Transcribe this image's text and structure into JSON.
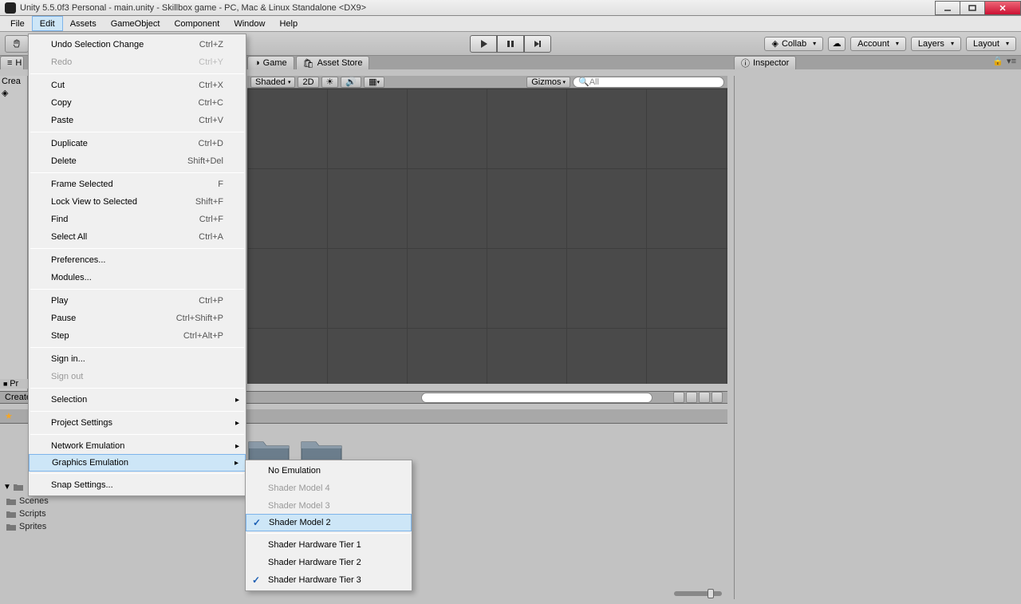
{
  "window": {
    "title": "Unity 5.5.0f3 Personal - main.unity - Skillbox game - PC, Mac & Linux Standalone <DX9>"
  },
  "menubar": {
    "file": "File",
    "edit": "Edit",
    "assets": "Assets",
    "gameobject": "GameObject",
    "component": "Component",
    "window": "Window",
    "help": "Help"
  },
  "toolbar": {
    "collab": "Collab",
    "account": "Account",
    "layers": "Layers",
    "layout": "Layout"
  },
  "tabs": {
    "hierarchy": "H",
    "game": "Game",
    "assetstore": "Asset Store",
    "inspector": "Inspector",
    "project": "P"
  },
  "scene_toolbar": {
    "shaded": "Shaded",
    "twod": "2D",
    "gizmos": "Gizmos",
    "search_placeholder": "All"
  },
  "edit_menu": {
    "undo": {
      "l": "Undo Selection Change",
      "s": "Ctrl+Z"
    },
    "redo": {
      "l": "Redo",
      "s": "Ctrl+Y"
    },
    "cut": {
      "l": "Cut",
      "s": "Ctrl+X"
    },
    "copy": {
      "l": "Copy",
      "s": "Ctrl+C"
    },
    "paste": {
      "l": "Paste",
      "s": "Ctrl+V"
    },
    "duplicate": {
      "l": "Duplicate",
      "s": "Ctrl+D"
    },
    "delete": {
      "l": "Delete",
      "s": "Shift+Del"
    },
    "frame": {
      "l": "Frame Selected",
      "s": "F"
    },
    "lockview": {
      "l": "Lock View to Selected",
      "s": "Shift+F"
    },
    "find": {
      "l": "Find",
      "s": "Ctrl+F"
    },
    "selectall": {
      "l": "Select All",
      "s": "Ctrl+A"
    },
    "prefs": {
      "l": "Preferences..."
    },
    "modules": {
      "l": "Modules..."
    },
    "play": {
      "l": "Play",
      "s": "Ctrl+P"
    },
    "pause": {
      "l": "Pause",
      "s": "Ctrl+Shift+P"
    },
    "step": {
      "l": "Step",
      "s": "Ctrl+Alt+P"
    },
    "signin": {
      "l": "Sign in..."
    },
    "signout": {
      "l": "Sign out"
    },
    "selection": {
      "l": "Selection"
    },
    "projectsettings": {
      "l": "Project Settings"
    },
    "networkemu": {
      "l": "Network Emulation"
    },
    "graphicsemu": {
      "l": "Graphics Emulation"
    },
    "snap": {
      "l": "Snap Settings..."
    }
  },
  "graphics_submenu": {
    "noemulation": "No Emulation",
    "sm4": "Shader Model 4",
    "sm3": "Shader Model 3",
    "sm2": "Shader Model 2",
    "tier1": "Shader Hardware Tier 1",
    "tier2": "Shader Hardware Tier 2",
    "tier3": "Shader Hardware Tier 3"
  },
  "project": {
    "create": "Create",
    "folders": {
      "scenes": "Scenes",
      "scripts": "Scripts",
      "sprites": "Sprites"
    }
  },
  "hierarchy": {
    "create": "Crea"
  },
  "misc": {
    "pr": "Pr",
    "crea": "Crea",
    "h": "H"
  }
}
